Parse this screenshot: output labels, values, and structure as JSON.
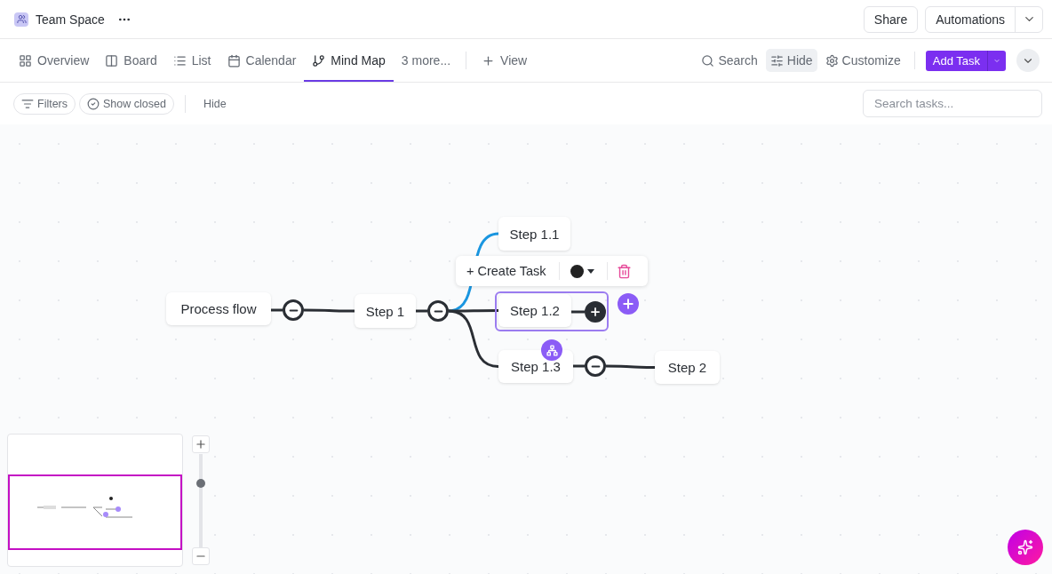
{
  "header": {
    "space_name": "Team Space",
    "actions": [
      {
        "label": "Share",
        "kind": "plain"
      },
      {
        "label": "Automations",
        "kind": "split"
      }
    ]
  },
  "views": [
    {
      "label": "Overview",
      "selected": false
    },
    {
      "label": "Board",
      "selected": false
    },
    {
      "label": "List",
      "selected": false
    },
    {
      "label": "Calendar",
      "selected": false
    },
    {
      "label": "Mind Map",
      "selected": true
    }
  ],
  "more_views": "3 more...",
  "add_view": "View",
  "toolbar": [
    {
      "label": "Search",
      "active": false
    },
    {
      "label": "Hide",
      "active": true
    },
    {
      "label": "Customize",
      "active": false
    }
  ],
  "add_task": "Add Task",
  "filters": [
    {
      "label": "Filters"
    },
    {
      "label": "Show closed"
    }
  ],
  "hide_label": "Hide",
  "search": {
    "placeholder": "Search tasks..."
  },
  "mind_map": {
    "root": {
      "label": "Process flow",
      "selected": false,
      "expanded": true,
      "children": [
        {
          "label": "Step 1",
          "selected": false,
          "expanded": true,
          "children": [
            {
              "label": "Step 1.1",
              "selected": false,
              "link_highlighted": true
            },
            {
              "label": "Step 1.2",
              "selected": true,
              "link_highlighted": false
            },
            {
              "label": "Step 1.3",
              "selected": false,
              "link_highlighted": false,
              "expanded": true,
              "children": [
                {
                  "label": "Step 2",
                  "selected": false
                }
              ]
            }
          ]
        }
      ]
    },
    "node_toolbar": {
      "create_label": "+ Create Task",
      "color": "#222222"
    }
  },
  "zoom": {
    "level": 0.69
  }
}
